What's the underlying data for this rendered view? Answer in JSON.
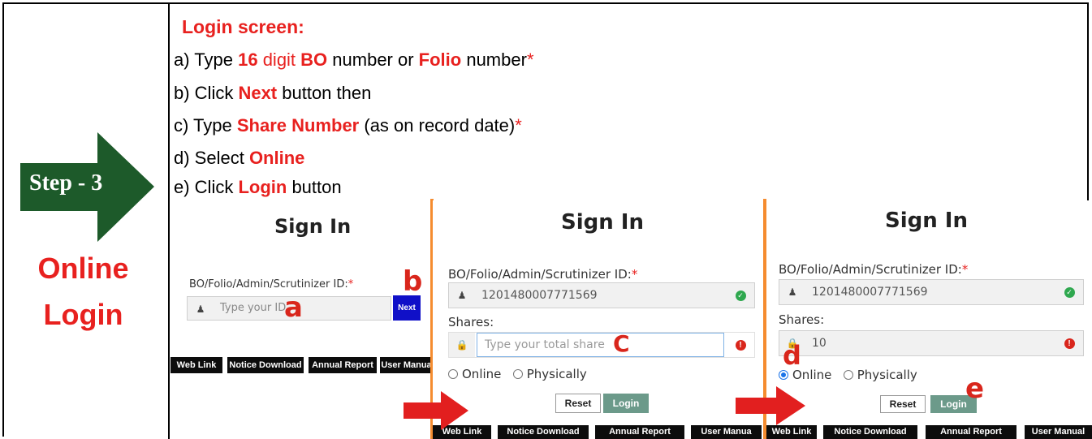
{
  "step": {
    "label": "Step - 3",
    "title_line1": "Online",
    "title_line2": "Login"
  },
  "instructions": {
    "heading": "Login screen:",
    "a": {
      "p1": "a) Type ",
      "num": "16",
      "p2": " digit ",
      "bo": "BO",
      "p3": " number or ",
      "folio": "Folio",
      "p4": " number",
      "star": "*"
    },
    "b": {
      "p1": "b) Click ",
      "next": "Next",
      "p2": " button then"
    },
    "c": {
      "p1": "c) Type ",
      "share": "Share Number",
      "p2": " (as on record date)",
      "star": "*"
    },
    "d": {
      "p1": "d) Select ",
      "online": "Online"
    },
    "e": {
      "p1": "e) Click ",
      "login": "Login",
      "p2": " button"
    }
  },
  "panel1": {
    "title": "Sign In",
    "id_label": "BO/Folio/Admin/Scrutinizer ID:",
    "star": "*",
    "id_placeholder": "Type your ID",
    "next_label": "Next",
    "marker_a": "a",
    "marker_b": "b",
    "tabs": [
      "Web Link",
      "Notice Download",
      "Annual Report",
      "User Manua"
    ]
  },
  "panel2": {
    "title": "Sign In",
    "id_label": "BO/Folio/Admin/Scrutinizer ID:",
    "star": "*",
    "id_value": "1201480007771569",
    "shares_label": "Shares:",
    "shares_placeholder": "Type your total share",
    "marker_c": "C",
    "online_label": "Online",
    "physically_label": "Physically",
    "reset_label": "Reset",
    "login_label": "Login",
    "tabs": [
      "Web Link",
      "Notice Download",
      "Annual Report",
      "User Manua"
    ]
  },
  "panel3": {
    "title": "Sign In",
    "id_label": "BO/Folio/Admin/Scrutinizer ID:",
    "star": "*",
    "id_value": "1201480007771569",
    "shares_label": "Shares:",
    "shares_value": "10",
    "marker_d": "d",
    "marker_e": "e",
    "online_label": "Online",
    "physically_label": "Physically",
    "reset_label": "Reset",
    "login_label": "Login",
    "tabs": [
      "Web Link",
      "Notice Download",
      "Annual Report",
      "User Manual"
    ]
  },
  "colors": {
    "accent_red": "#e8211f",
    "step_green": "#1d5a2a",
    "separator_orange": "#f58c2f",
    "next_blue": "#1010c8",
    "login_green": "#6c9a8a"
  }
}
